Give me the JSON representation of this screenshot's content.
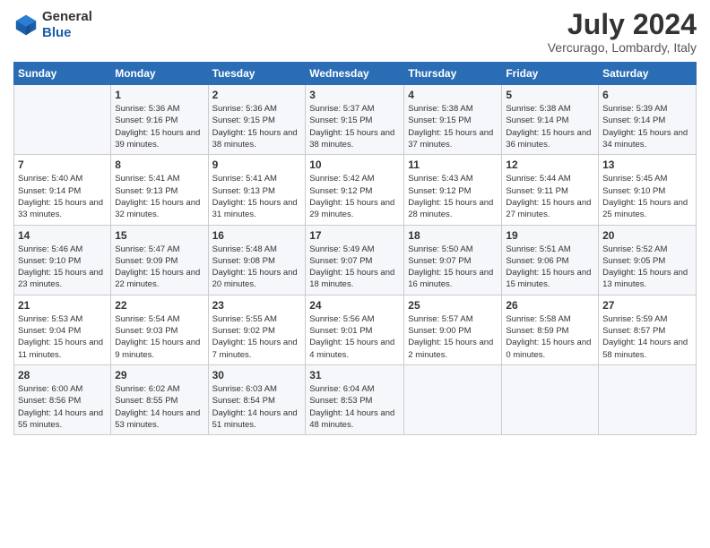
{
  "header": {
    "logo_line1": "General",
    "logo_line2": "Blue",
    "month_year": "July 2024",
    "location": "Vercurago, Lombardy, Italy"
  },
  "columns": [
    "Sunday",
    "Monday",
    "Tuesday",
    "Wednesday",
    "Thursday",
    "Friday",
    "Saturday"
  ],
  "weeks": [
    {
      "days": [
        {
          "num": "",
          "sunrise": "",
          "sunset": "",
          "daylight": ""
        },
        {
          "num": "1",
          "sunrise": "Sunrise: 5:36 AM",
          "sunset": "Sunset: 9:16 PM",
          "daylight": "Daylight: 15 hours and 39 minutes."
        },
        {
          "num": "2",
          "sunrise": "Sunrise: 5:36 AM",
          "sunset": "Sunset: 9:15 PM",
          "daylight": "Daylight: 15 hours and 38 minutes."
        },
        {
          "num": "3",
          "sunrise": "Sunrise: 5:37 AM",
          "sunset": "Sunset: 9:15 PM",
          "daylight": "Daylight: 15 hours and 38 minutes."
        },
        {
          "num": "4",
          "sunrise": "Sunrise: 5:38 AM",
          "sunset": "Sunset: 9:15 PM",
          "daylight": "Daylight: 15 hours and 37 minutes."
        },
        {
          "num": "5",
          "sunrise": "Sunrise: 5:38 AM",
          "sunset": "Sunset: 9:14 PM",
          "daylight": "Daylight: 15 hours and 36 minutes."
        },
        {
          "num": "6",
          "sunrise": "Sunrise: 5:39 AM",
          "sunset": "Sunset: 9:14 PM",
          "daylight": "Daylight: 15 hours and 34 minutes."
        }
      ]
    },
    {
      "days": [
        {
          "num": "7",
          "sunrise": "Sunrise: 5:40 AM",
          "sunset": "Sunset: 9:14 PM",
          "daylight": "Daylight: 15 hours and 33 minutes."
        },
        {
          "num": "8",
          "sunrise": "Sunrise: 5:41 AM",
          "sunset": "Sunset: 9:13 PM",
          "daylight": "Daylight: 15 hours and 32 minutes."
        },
        {
          "num": "9",
          "sunrise": "Sunrise: 5:41 AM",
          "sunset": "Sunset: 9:13 PM",
          "daylight": "Daylight: 15 hours and 31 minutes."
        },
        {
          "num": "10",
          "sunrise": "Sunrise: 5:42 AM",
          "sunset": "Sunset: 9:12 PM",
          "daylight": "Daylight: 15 hours and 29 minutes."
        },
        {
          "num": "11",
          "sunrise": "Sunrise: 5:43 AM",
          "sunset": "Sunset: 9:12 PM",
          "daylight": "Daylight: 15 hours and 28 minutes."
        },
        {
          "num": "12",
          "sunrise": "Sunrise: 5:44 AM",
          "sunset": "Sunset: 9:11 PM",
          "daylight": "Daylight: 15 hours and 27 minutes."
        },
        {
          "num": "13",
          "sunrise": "Sunrise: 5:45 AM",
          "sunset": "Sunset: 9:10 PM",
          "daylight": "Daylight: 15 hours and 25 minutes."
        }
      ]
    },
    {
      "days": [
        {
          "num": "14",
          "sunrise": "Sunrise: 5:46 AM",
          "sunset": "Sunset: 9:10 PM",
          "daylight": "Daylight: 15 hours and 23 minutes."
        },
        {
          "num": "15",
          "sunrise": "Sunrise: 5:47 AM",
          "sunset": "Sunset: 9:09 PM",
          "daylight": "Daylight: 15 hours and 22 minutes."
        },
        {
          "num": "16",
          "sunrise": "Sunrise: 5:48 AM",
          "sunset": "Sunset: 9:08 PM",
          "daylight": "Daylight: 15 hours and 20 minutes."
        },
        {
          "num": "17",
          "sunrise": "Sunrise: 5:49 AM",
          "sunset": "Sunset: 9:07 PM",
          "daylight": "Daylight: 15 hours and 18 minutes."
        },
        {
          "num": "18",
          "sunrise": "Sunrise: 5:50 AM",
          "sunset": "Sunset: 9:07 PM",
          "daylight": "Daylight: 15 hours and 16 minutes."
        },
        {
          "num": "19",
          "sunrise": "Sunrise: 5:51 AM",
          "sunset": "Sunset: 9:06 PM",
          "daylight": "Daylight: 15 hours and 15 minutes."
        },
        {
          "num": "20",
          "sunrise": "Sunrise: 5:52 AM",
          "sunset": "Sunset: 9:05 PM",
          "daylight": "Daylight: 15 hours and 13 minutes."
        }
      ]
    },
    {
      "days": [
        {
          "num": "21",
          "sunrise": "Sunrise: 5:53 AM",
          "sunset": "Sunset: 9:04 PM",
          "daylight": "Daylight: 15 hours and 11 minutes."
        },
        {
          "num": "22",
          "sunrise": "Sunrise: 5:54 AM",
          "sunset": "Sunset: 9:03 PM",
          "daylight": "Daylight: 15 hours and 9 minutes."
        },
        {
          "num": "23",
          "sunrise": "Sunrise: 5:55 AM",
          "sunset": "Sunset: 9:02 PM",
          "daylight": "Daylight: 15 hours and 7 minutes."
        },
        {
          "num": "24",
          "sunrise": "Sunrise: 5:56 AM",
          "sunset": "Sunset: 9:01 PM",
          "daylight": "Daylight: 15 hours and 4 minutes."
        },
        {
          "num": "25",
          "sunrise": "Sunrise: 5:57 AM",
          "sunset": "Sunset: 9:00 PM",
          "daylight": "Daylight: 15 hours and 2 minutes."
        },
        {
          "num": "26",
          "sunrise": "Sunrise: 5:58 AM",
          "sunset": "Sunset: 8:59 PM",
          "daylight": "Daylight: 15 hours and 0 minutes."
        },
        {
          "num": "27",
          "sunrise": "Sunrise: 5:59 AM",
          "sunset": "Sunset: 8:57 PM",
          "daylight": "Daylight: 14 hours and 58 minutes."
        }
      ]
    },
    {
      "days": [
        {
          "num": "28",
          "sunrise": "Sunrise: 6:00 AM",
          "sunset": "Sunset: 8:56 PM",
          "daylight": "Daylight: 14 hours and 55 minutes."
        },
        {
          "num": "29",
          "sunrise": "Sunrise: 6:02 AM",
          "sunset": "Sunset: 8:55 PM",
          "daylight": "Daylight: 14 hours and 53 minutes."
        },
        {
          "num": "30",
          "sunrise": "Sunrise: 6:03 AM",
          "sunset": "Sunset: 8:54 PM",
          "daylight": "Daylight: 14 hours and 51 minutes."
        },
        {
          "num": "31",
          "sunrise": "Sunrise: 6:04 AM",
          "sunset": "Sunset: 8:53 PM",
          "daylight": "Daylight: 14 hours and 48 minutes."
        },
        {
          "num": "",
          "sunrise": "",
          "sunset": "",
          "daylight": ""
        },
        {
          "num": "",
          "sunrise": "",
          "sunset": "",
          "daylight": ""
        },
        {
          "num": "",
          "sunrise": "",
          "sunset": "",
          "daylight": ""
        }
      ]
    }
  ]
}
